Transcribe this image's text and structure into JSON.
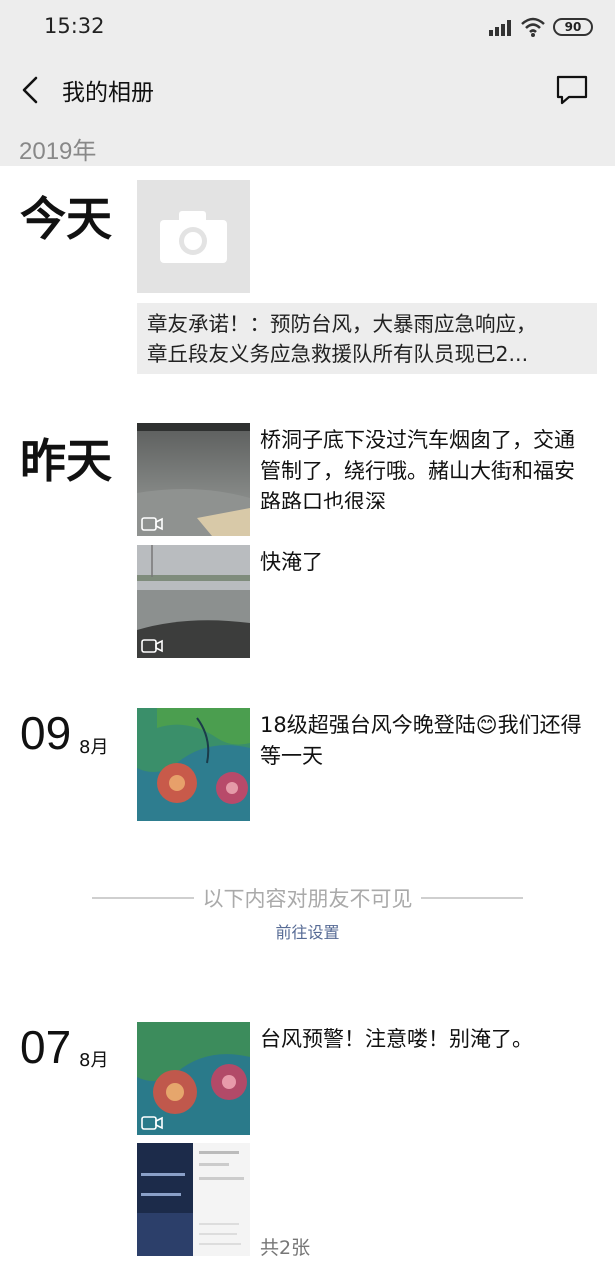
{
  "status_bar": {
    "time": "15:32",
    "battery": "90"
  },
  "nav": {
    "title": "我的相册"
  },
  "year": "2019年",
  "groups": {
    "today": {
      "day_label": "今天",
      "share_caption_line1": "章友承诺！：预防台风，大暴雨应急响应，",
      "share_caption_line2": "章丘段友义务应急救援队所有队员现已2..."
    },
    "yesterday": {
      "day_label": "昨天",
      "post1_text": "桥洞子底下没过汽车烟囱了，交通管制了，绕行哦。赭山大街和福安路路口也很深",
      "post2_text": "快淹了"
    },
    "aug09": {
      "day": "09",
      "month": "8月",
      "post_text": "18级超强台风今晚登陆😊我们还得等一天"
    },
    "aug07": {
      "day": "07",
      "month": "8月",
      "post1_text": "台风预警！注意喽！别淹了。",
      "post2_count": "共2张"
    }
  },
  "divider": {
    "text": "以下内容对朋友不可见",
    "link": "前往设置"
  },
  "icons": [
    "back-icon",
    "comment-icon",
    "camera-icon",
    "video-icon",
    "signal-icon",
    "wifi-icon",
    "battery-icon"
  ],
  "colors": {
    "header_bg": "#ededed",
    "link": "#576b95",
    "muted": "#888888"
  }
}
